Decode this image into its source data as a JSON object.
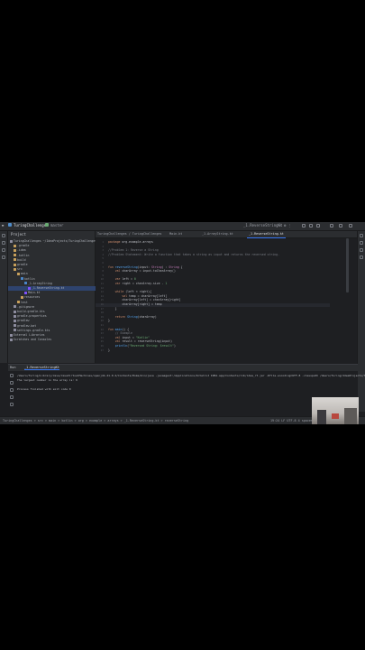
{
  "window": {
    "menu_label": "≡",
    "project_name": "TuringChallenges",
    "branch": "master",
    "run_config": "_1.ReverseStringKt",
    "right_controls": "▷ ⚙ ⋮"
  },
  "project_panel": {
    "title": "Project",
    "tree": [
      {
        "label": "TuringChallenges  ~/IdeaProjects/TuringChallenges",
        "indent": 0,
        "color": "#8e8ea0"
      },
      {
        "label": ".gradle",
        "indent": 1,
        "color": "#c9a15c"
      },
      {
        "label": ".idea",
        "indent": 1,
        "color": "#c9a15c"
      },
      {
        "label": ".kotlin",
        "indent": 1,
        "color": "#c9a15c"
      },
      {
        "label": "build",
        "indent": 1,
        "color": "#c9a15c"
      },
      {
        "label": "gradle",
        "indent": 1,
        "color": "#c9a15c"
      },
      {
        "label": "src",
        "indent": 1,
        "color": "#c9a15c"
      },
      {
        "label": "main",
        "indent": 2,
        "color": "#c9a15c"
      },
      {
        "label": "kotlin",
        "indent": 3,
        "color": "#4a86c8"
      },
      {
        "label": "_1.ArrayString",
        "indent": 4,
        "color": "#4a86c8"
      },
      {
        "label": "_1.ReverseString.kt",
        "indent": 5,
        "color": "#7f52ff",
        "selected": true
      },
      {
        "label": "Main.kt",
        "indent": 4,
        "color": "#7f52ff"
      },
      {
        "label": "resources",
        "indent": 3,
        "color": "#c9a15c"
      },
      {
        "label": "test",
        "indent": 2,
        "color": "#c9a15c"
      },
      {
        "label": ".gitignore",
        "indent": 1,
        "color": "#8e8ea0"
      },
      {
        "label": "build.gradle.kts",
        "indent": 1,
        "color": "#8e8ea0"
      },
      {
        "label": "gradle.properties",
        "indent": 1,
        "color": "#8e8ea0"
      },
      {
        "label": "gradlew",
        "indent": 1,
        "color": "#8e8ea0"
      },
      {
        "label": "gradlew.bat",
        "indent": 1,
        "color": "#8e8ea0"
      },
      {
        "label": "settings.gradle.kts",
        "indent": 1,
        "color": "#8e8ea0"
      },
      {
        "label": "External Libraries",
        "indent": 0,
        "color": "#8e8ea0"
      },
      {
        "label": "Scratches and Consoles",
        "indent": 0,
        "color": "#8e8ea0"
      }
    ]
  },
  "tabs": [
    {
      "label": "TuringChallenges / TuringChallenges",
      "active": false
    },
    {
      "label": "Main.kt",
      "active": false
    },
    {
      "label": "_1.ArrayString.kt",
      "active": false
    },
    {
      "label": "_1.ReverseString.kt",
      "active": true
    }
  ],
  "editor": {
    "lines": [
      {
        "n": "1",
        "html": "<span class=\"kw\">package</span> org.example.arrays"
      },
      {
        "n": "2",
        "html": ""
      },
      {
        "n": "3",
        "html": "<span class=\"cm\">//Problem 1: Reverse a String</span>"
      },
      {
        "n": "4",
        "html": "<span class=\"cm\">//Problem Statement: Write a function that takes a string as input and returns the reversed string.</span>"
      },
      {
        "n": "5",
        "html": ""
      },
      {
        "n": "6",
        "html": ""
      },
      {
        "n": "7",
        "html": "<span class=\"kw\">fun</span> <span class=\"fn\">reverseString</span>(input: <span class=\"tp\">String</span>) : <span class=\"tp\">String</span> {"
      },
      {
        "n": "8",
        "html": "    <span class=\"kw\">val</span> charArray = input.toCharArray()"
      },
      {
        "n": "9",
        "html": ""
      },
      {
        "n": "10",
        "html": "    <span class=\"kw\">var</span> left = <span class=\"st\">0</span>"
      },
      {
        "n": "11",
        "html": "    <span class=\"kw\">var</span> right = charArray.size - <span class=\"st\">1</span>"
      },
      {
        "n": "12",
        "html": ""
      },
      {
        "n": "13",
        "html": "    <span class=\"kw\">while</span> (left &lt; right){"
      },
      {
        "n": "14",
        "html": "        <span class=\"kw\">val</span> temp = charArray[left]"
      },
      {
        "n": "15",
        "html": "        charArray[left] = charArray[right]"
      },
      {
        "n": "16",
        "html": "        charArray[right] = temp"
      },
      {
        "n": "17",
        "html": "    }"
      },
      {
        "n": "18",
        "html": ""
      },
      {
        "n": "19",
        "html": "    <span class=\"kw\">return</span> <span class=\"fn\">String</span>(charArray)"
      },
      {
        "n": "20",
        "html": "}"
      },
      {
        "n": "21",
        "html": ""
      },
      {
        "n": "22",
        "html": "<span class=\"kw\">fun</span> <span class=\"fn\">main</span>() {"
      },
      {
        "n": "23",
        "html": "    <span class=\"cm\">// Example</span>"
      },
      {
        "n": "24",
        "html": "    <span class=\"kw\">val</span> input = <span class=\"st\">\"Kotlin\"</span>"
      },
      {
        "n": "25",
        "html": "    <span class=\"kw\">val</span> result = reverseString(input)"
      },
      {
        "n": "26",
        "html": "    <span class=\"fn\">println</span>(<span class=\"st\">\"Reversed String: $result\"</span>)"
      },
      {
        "n": "27",
        "html": "}"
      }
    ]
  },
  "run_panel": {
    "label": "Run",
    "tab": "_1.ReverseStringKt",
    "output": [
      "/Users/Turing/Library/Java/JavaVirtualMachines/openjdk-21.0.2/Contents/Home/bin/java -javaagent:/Applications/IntelliJ IDEA.app/Contents/lib/idea_rt.jar -Dfile.encoding=UTF-8 -classpath /Users/Turing/IdeaProjects/TuringChallenges/build/classes/kotlin/main",
      "The largest number in the array is: 9",
      "",
      "Process finished with exit code 0"
    ]
  },
  "status_bar": {
    "path": "TuringChallenges > src > main > kotlin > org > example > arrays > _1.ReverseString.kt > reverseString",
    "right": "19:24   LF   UTF-8   4 spaces"
  }
}
